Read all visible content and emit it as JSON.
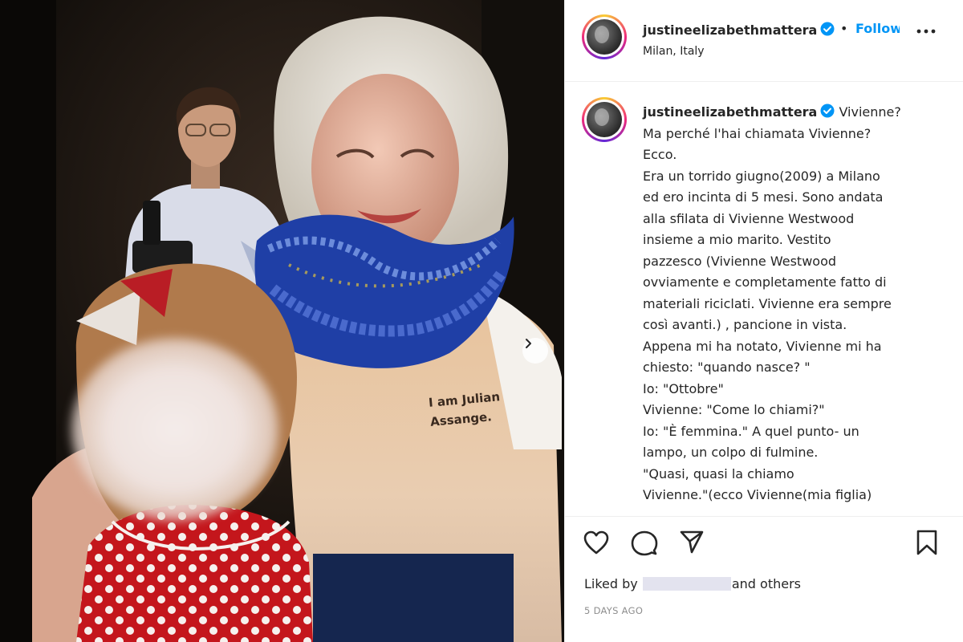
{
  "post": {
    "username": "justineelizabethmattera",
    "separator": "•",
    "follow_label": "Follow",
    "location": "Milan, Italy",
    "more_icon": "more-horizontal-icon",
    "verified_color": "#0095f6"
  },
  "photo": {
    "shirt_text_line1": "I am Julian",
    "shirt_text_line2": "Assange.",
    "next_icon": "chevron-right-icon"
  },
  "caption": {
    "username": "justineelizabethmattera",
    "lines": [
      "Vivienne?",
      "Ma perché l'hai chiamata Vivienne?",
      "Ecco.",
      "Era un torrido giugno(2009) a Milano",
      "ed ero incinta di 5 mesi. Sono andata",
      "alla sfilata di Vivienne Westwood",
      "insieme a mio marito. Vestito",
      "pazzesco (Vivienne Westwood",
      "ovviamente e completamente fatto di",
      "materiali riciclati. Vivienne era sempre",
      "così avanti.) , pancione in vista.",
      "Appena mi ha notato, Vivienne mi ha",
      "chiesto: \"quando nasce? \"",
      "Io: \"Ottobre\"",
      "Vivienne: \"Come lo chiami?\"",
      "Io: \"È femmina.\" A quel punto- un",
      "lampo, un colpo di fulmine.",
      "\"Quasi, quasi la chiamo",
      "Vivienne.\"(ecco Vivienne(mia figlia)"
    ]
  },
  "actions": {
    "like_icon": "heart-icon",
    "comment_icon": "comment-icon",
    "share_icon": "share-icon",
    "save_icon": "bookmark-icon",
    "liked_prefix": "Liked by",
    "liked_suffix": "and others",
    "timestamp": "5 DAYS AGO"
  }
}
